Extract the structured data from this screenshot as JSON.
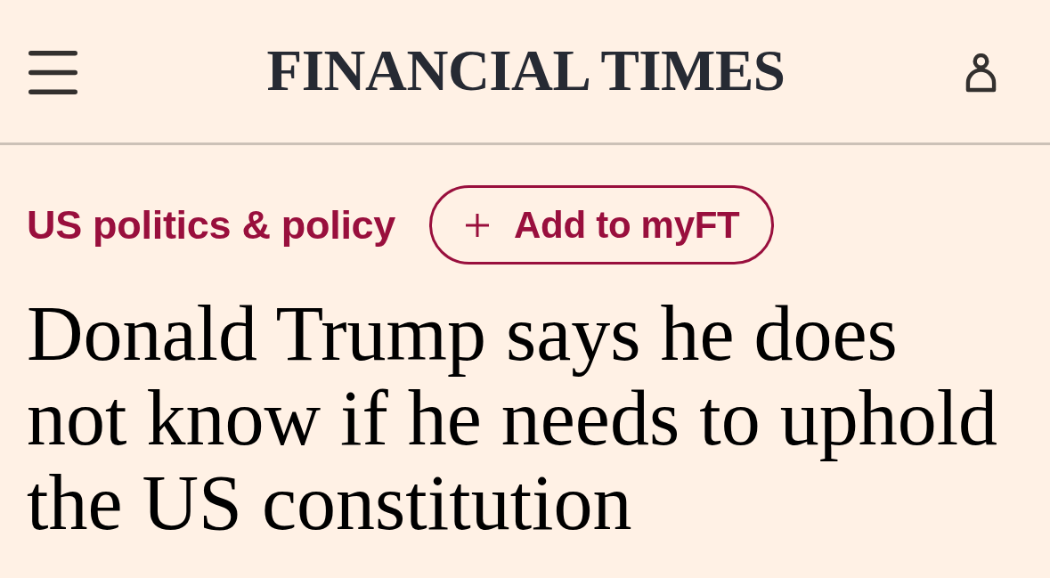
{
  "header": {
    "logo": "FINANCIAL TIMES"
  },
  "article": {
    "topic": "US politics & policy",
    "follow_button": {
      "label": "Add to myFT"
    },
    "headline": "Donald Trump says he does not know if he needs to uphold the US constitution"
  }
}
